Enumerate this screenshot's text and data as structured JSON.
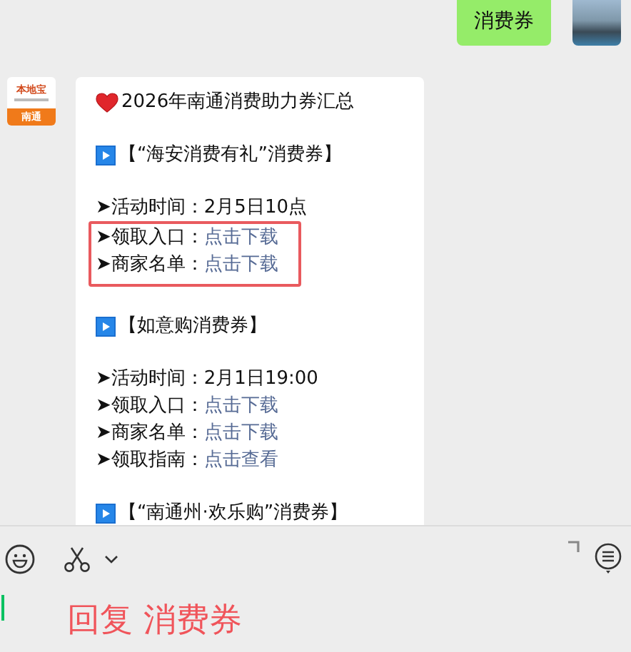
{
  "outgoing": {
    "text": "消费券"
  },
  "incoming": {
    "logo": {
      "brand": "本地宝",
      "city": "南通"
    },
    "blocks": [
      {
        "kind": "heading",
        "text": "2026年南通消费助力券汇总"
      },
      {
        "kind": "blank"
      },
      {
        "kind": "section",
        "text": "【“海安消费有礼”消费券】"
      },
      {
        "kind": "blank"
      },
      {
        "kind": "line",
        "label": "➤活动时间：",
        "value": "2月5日10点",
        "link": false
      },
      {
        "kind": "boxed",
        "lines": [
          {
            "label": "➤领取入口：",
            "value": "点击下载",
            "link": true
          },
          {
            "label": "➤商家名单：",
            "value": "点击下载",
            "link": true
          }
        ]
      },
      {
        "kind": "blank"
      },
      {
        "kind": "section",
        "text": "【如意购消费券】"
      },
      {
        "kind": "blank"
      },
      {
        "kind": "line",
        "label": "➤活动时间：",
        "value": "2月1日19:00",
        "link": false
      },
      {
        "kind": "line",
        "label": "➤领取入口：",
        "value": "点击下载",
        "link": true
      },
      {
        "kind": "line",
        "label": "➤商家名单：",
        "value": "点击下载",
        "link": true
      },
      {
        "kind": "line",
        "label": "➤领取指南：",
        "value": "点击查看",
        "link": true
      },
      {
        "kind": "blank"
      },
      {
        "kind": "section",
        "text": "【“南通州·欢乐购”消费券】"
      }
    ]
  },
  "composer": {
    "annotation": "回复 消费券"
  }
}
